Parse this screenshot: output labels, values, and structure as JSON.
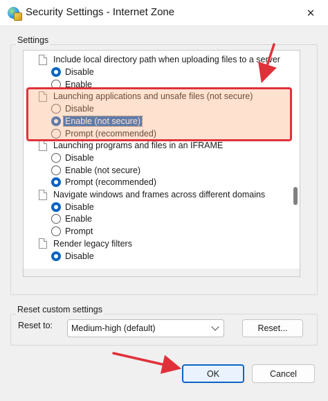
{
  "window": {
    "title": "Security Settings - Internet Zone",
    "close_glyph": "✕"
  },
  "settings_group": {
    "label": "Settings"
  },
  "settings_list": {
    "cut_text": "Include local directory path when uploading files to a server",
    "items": [
      {
        "kind": "option",
        "label": "Disable",
        "checked": true
      },
      {
        "kind": "option",
        "label": "Enable",
        "checked": false
      },
      {
        "kind": "setting",
        "label": "Launching applications and unsafe files (not secure)"
      },
      {
        "kind": "option",
        "label": "Disable",
        "checked": false
      },
      {
        "kind": "option",
        "label": "Enable (not secure)",
        "checked": true,
        "selected": true
      },
      {
        "kind": "option",
        "label": "Prompt (recommended)",
        "checked": false
      },
      {
        "kind": "setting",
        "label": "Launching programs and files in an IFRAME"
      },
      {
        "kind": "option",
        "label": "Disable",
        "checked": false
      },
      {
        "kind": "option",
        "label": "Enable (not secure)",
        "checked": false
      },
      {
        "kind": "option",
        "label": "Prompt (recommended)",
        "checked": true
      },
      {
        "kind": "setting",
        "label": "Navigate windows and frames across different domains"
      },
      {
        "kind": "option",
        "label": "Disable",
        "checked": true
      },
      {
        "kind": "option",
        "label": "Enable",
        "checked": false
      },
      {
        "kind": "option",
        "label": "Prompt",
        "checked": false
      },
      {
        "kind": "setting",
        "label": "Render legacy filters"
      },
      {
        "kind": "option",
        "label": "Disable",
        "checked": true
      }
    ]
  },
  "reset_group": {
    "label": "Reset custom settings",
    "reset_to_label": "Reset to:",
    "selected_level": "Medium-high (default)",
    "reset_button": "Reset..."
  },
  "footer": {
    "ok_button": "OK",
    "cancel_button": "Cancel"
  },
  "colors": {
    "accent": "#0a64c4",
    "annotation": "#e0313a"
  }
}
